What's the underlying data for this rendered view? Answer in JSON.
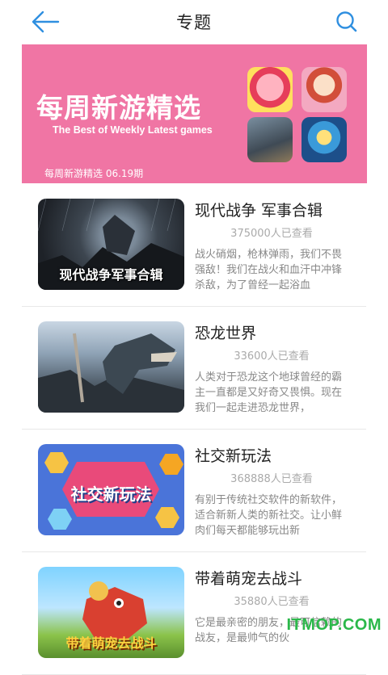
{
  "header": {
    "title": "专题"
  },
  "banner": {
    "title": "每周新游精选",
    "subtitle": "The Best of Weekly Latest games",
    "date_label": "每周新游精选 06.19期"
  },
  "items": [
    {
      "title": "现代战争 军事合辑",
      "views": "375000人已查看",
      "image_text": "现代战争军事合辑",
      "description": "战火硝烟，枪林弹雨，我们不畏强敌！我们在战火和血汗中冲锋杀敌，为了曾经一起浴血"
    },
    {
      "title": "恐龙世界",
      "views": "33600人已查看",
      "image_text": "",
      "description": "人类对于恐龙这个地球曾经的霸主一直都是又好奇又畏惧。现在我们一起走进恐龙世界，"
    },
    {
      "title": "社交新玩法",
      "views": "368888人已查看",
      "image_text": "社交新玩法",
      "description": "有别于传统社交软件的新软件，适合新新人类的新社交。让小鲜肉们每天都能够玩出新"
    },
    {
      "title": "带着萌宠去战斗",
      "views": "35880人已查看",
      "image_text": "带着萌宠去战斗",
      "description": "它是最亲密的朋友，最可信赖的战友，是最帅气的伙"
    }
  ],
  "watermark": "ITMOP.COM",
  "colors": {
    "accent": "#2f8fe0",
    "banner_bg": "#f075a4",
    "watermark": "#2bb84a"
  },
  "icons": {
    "back": "arrow-left-icon",
    "search": "search-icon"
  }
}
